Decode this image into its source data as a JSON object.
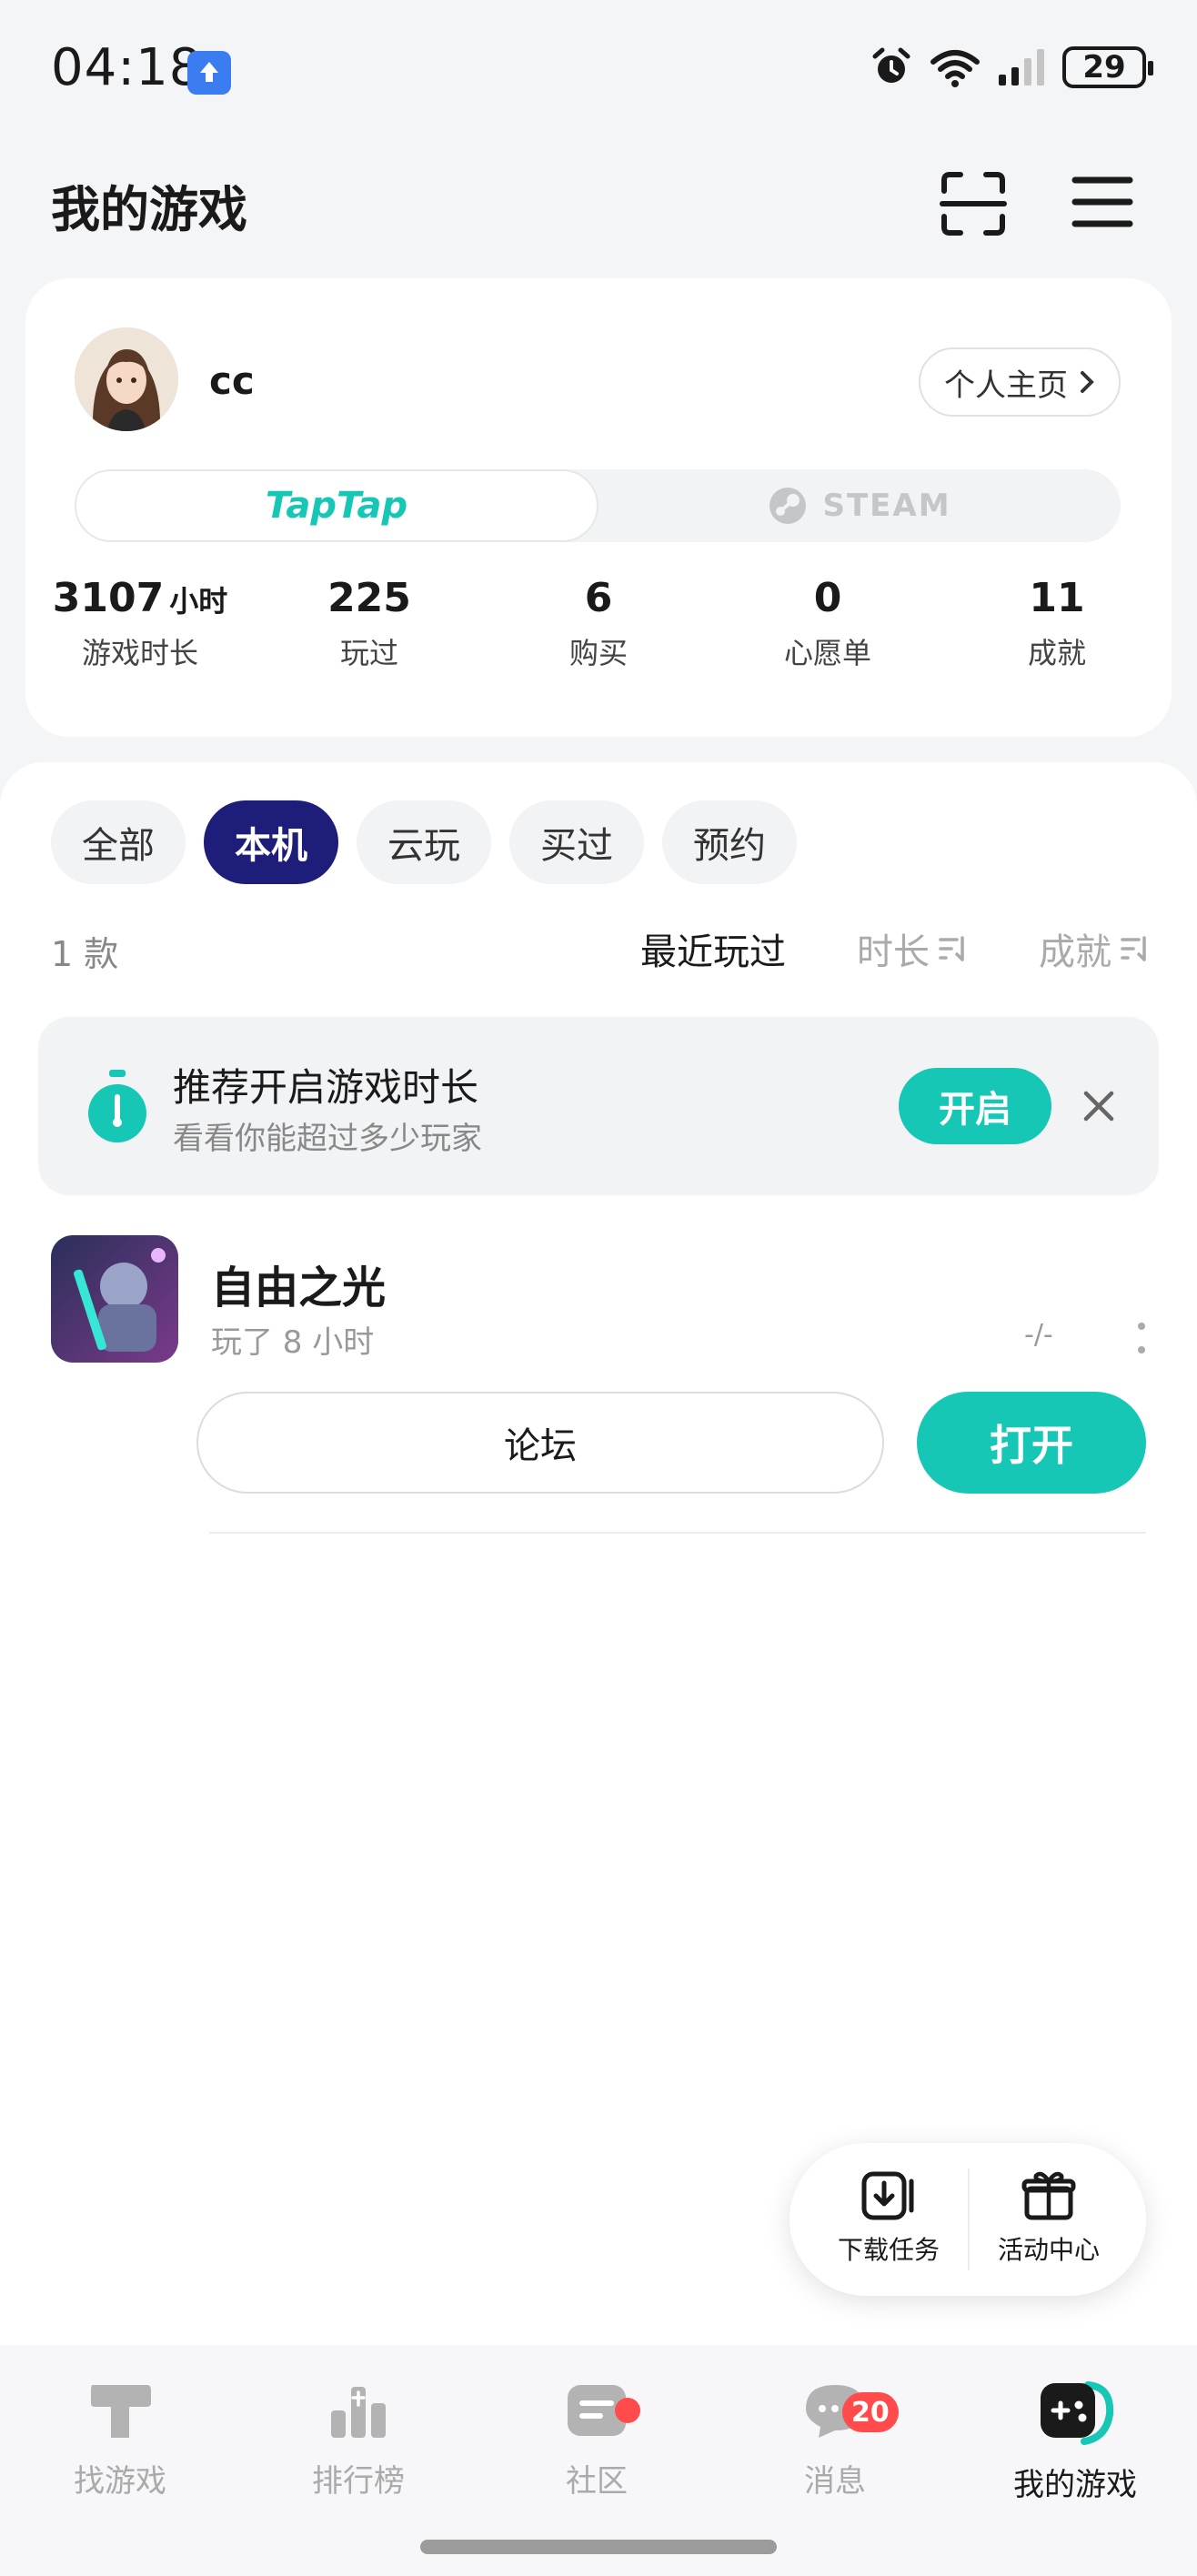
{
  "status_bar": {
    "time": "04:18",
    "battery": "29"
  },
  "header": {
    "title": "我的游戏"
  },
  "profile": {
    "username": "cc",
    "profile_link": "个人主页",
    "platforms": {
      "taptap": "TapTap",
      "steam": "STEAM"
    },
    "stats": [
      {
        "value": "3107",
        "unit": "小时",
        "label": "游戏时长"
      },
      {
        "value": "225",
        "unit": "",
        "label": "玩过"
      },
      {
        "value": "6",
        "unit": "",
        "label": "购买"
      },
      {
        "value": "0",
        "unit": "",
        "label": "心愿单"
      },
      {
        "value": "11",
        "unit": "",
        "label": "成就"
      }
    ]
  },
  "filters": [
    "全部",
    "本机",
    "云玩",
    "买过",
    "预约"
  ],
  "list": {
    "count": "1 款",
    "sort_options": [
      "最近玩过",
      "时长",
      "成就"
    ]
  },
  "promo": {
    "title": "推荐开启游戏时长",
    "subtitle": "看看你能超过多少玩家",
    "button": "开启"
  },
  "games": [
    {
      "title": "自由之光",
      "meta": "玩了 8 小时",
      "date": "-/-",
      "forum_button": "论坛",
      "open_button": "打开"
    }
  ],
  "floating": {
    "download": "下载任务",
    "events": "活动中心"
  },
  "bottom_nav": {
    "items": [
      "找游戏",
      "排行榜",
      "社区",
      "消息",
      "我的游戏"
    ],
    "message_badge": "20"
  },
  "colors": {
    "accent": "#16c7b6",
    "active_chip": "#1f1d7a",
    "badge": "#ff4b4b"
  }
}
